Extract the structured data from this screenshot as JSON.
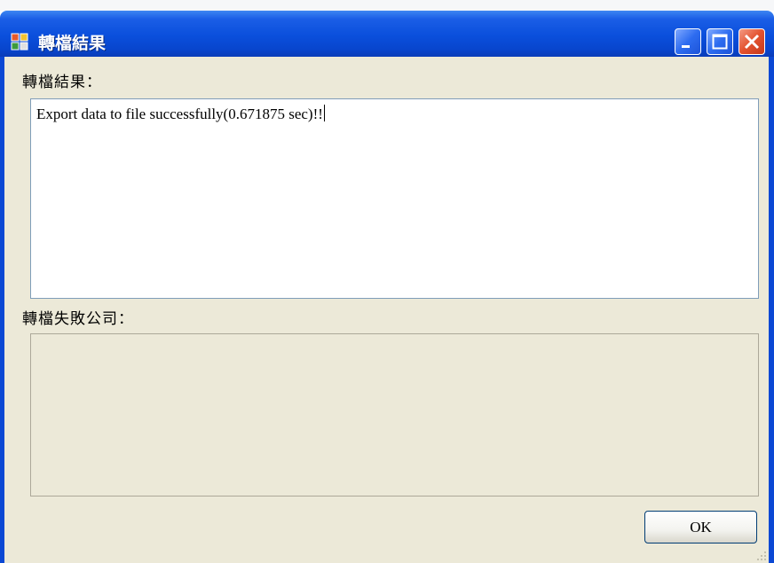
{
  "window": {
    "title": "轉檔結果",
    "controls": [
      "minimize",
      "maximize",
      "close"
    ],
    "icon": "app-window-icon"
  },
  "main": {
    "result_label": "轉檔結果：",
    "result_text": "Export data to file successfully(0.671875 sec)!!",
    "failed_label": "轉檔失敗公司：",
    "failed_text": "",
    "ok_label": "OK"
  },
  "colors": {
    "titlebar": "#0a4fdc",
    "client_background": "#ece9d8",
    "close_button": "#e3522f"
  }
}
